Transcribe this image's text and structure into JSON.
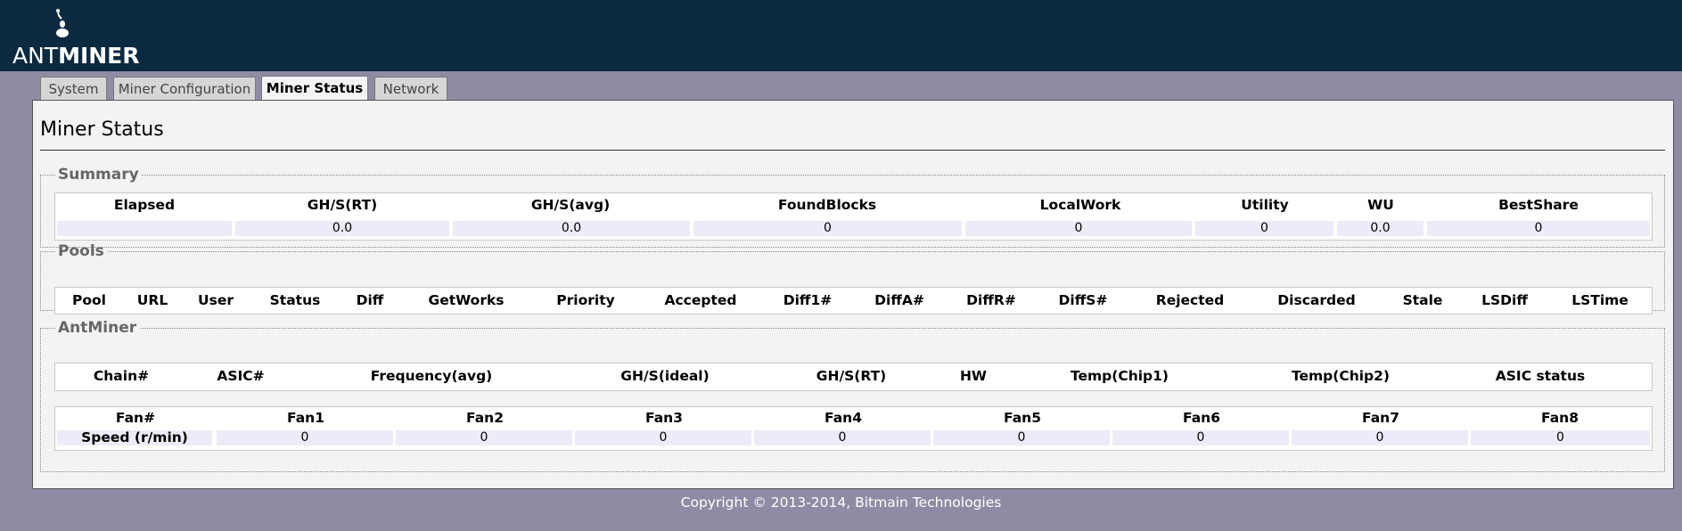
{
  "brand": {
    "part1": "ANT",
    "part2": "MINER"
  },
  "tabs": [
    {
      "label": "System"
    },
    {
      "label": "Miner Configuration"
    },
    {
      "label": "Miner Status"
    },
    {
      "label": "Network"
    }
  ],
  "page_title": "Miner Status",
  "summary": {
    "legend": "Summary",
    "headers": [
      "Elapsed",
      "GH/S(RT)",
      "GH/S(avg)",
      "FoundBlocks",
      "LocalWork",
      "Utility",
      "WU",
      "BestShare"
    ],
    "values": [
      "",
      "0.0",
      "0.0",
      "0",
      "0",
      "0",
      "0.0",
      "0"
    ]
  },
  "pools": {
    "legend": "Pools",
    "headers": [
      "Pool",
      "URL",
      "User",
      "Status",
      "Diff",
      "GetWorks",
      "Priority",
      "Accepted",
      "Diff1#",
      "DiffA#",
      "DiffR#",
      "DiffS#",
      "Rejected",
      "Discarded",
      "Stale",
      "LSDiff",
      "LSTime"
    ]
  },
  "antminer": {
    "legend": "AntMiner",
    "headers": [
      "Chain#",
      "ASIC#",
      "Frequency(avg)",
      "GH/S(ideal)",
      "GH/S(RT)",
      "HW",
      "Temp(Chip1)",
      "Temp(Chip2)",
      "ASIC status"
    ],
    "fan_headers": [
      "Fan#",
      "Fan1",
      "Fan2",
      "Fan3",
      "Fan4",
      "Fan5",
      "Fan6",
      "Fan7",
      "Fan8"
    ],
    "speed_label": "Speed (r/min)",
    "speeds": [
      "0",
      "0",
      "0",
      "0",
      "0",
      "0",
      "0",
      "0"
    ]
  },
  "footer": "Copyright © 2013-2014, Bitmain Technologies"
}
